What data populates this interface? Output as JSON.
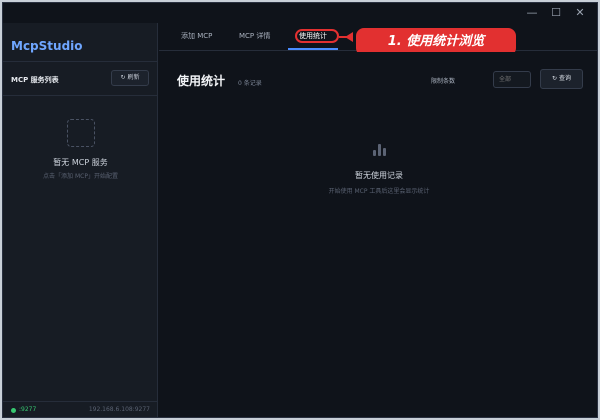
{
  "window": {
    "minimize": "—",
    "maximize": "☐",
    "close": "✕"
  },
  "sidebar": {
    "brand": "McpStudio",
    "list_title": "MCP 服务列表",
    "refresh_label": "↻ 刷新",
    "empty_title": "暂无 MCP 服务",
    "empty_subtitle": "点击「添加 MCP」开始配置",
    "footer_port": ":9277",
    "footer_address": "192.168.6.108:9277"
  },
  "tabs": [
    {
      "label": "添加 MCP"
    },
    {
      "label": "MCP 详情"
    },
    {
      "label": "使用统计"
    }
  ],
  "annotation": {
    "label": "1. 使用统计浏览",
    "color": "#e23030"
  },
  "main": {
    "title": "使用统计",
    "record_count": "0 条记录",
    "limit_label": "限制条数",
    "limit_placeholder": "全部",
    "query_label": "↻ 查询",
    "empty_title": "暂无使用记录",
    "empty_subtitle": "开始使用 MCP 工具后这里会显示统计"
  },
  "colors": {
    "accent": "#4a8cff",
    "brand": "#6fa6ff",
    "status_online": "#37c871"
  }
}
